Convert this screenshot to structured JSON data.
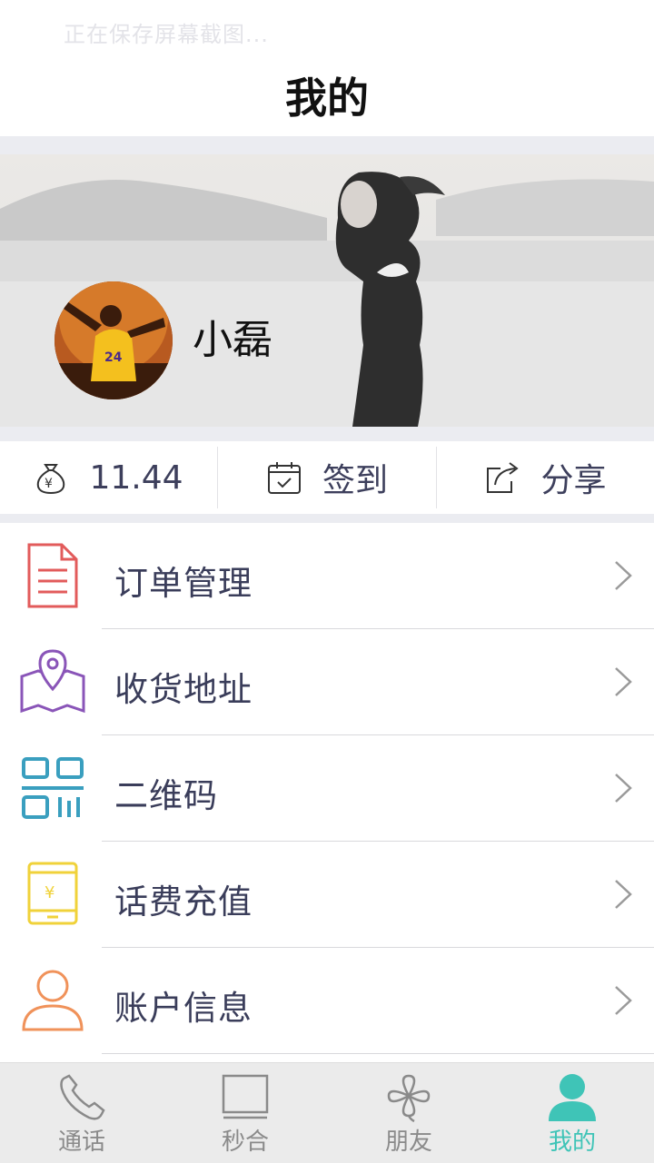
{
  "status": {
    "toast": "正在保存屏幕截图..."
  },
  "header": {
    "title": "我的"
  },
  "profile": {
    "name": "小磊",
    "avatar_icon": "user-avatar"
  },
  "quick_actions": [
    {
      "icon": "money-bag-icon",
      "label": "11.44"
    },
    {
      "icon": "calendar-check-icon",
      "label": "签到"
    },
    {
      "icon": "share-icon",
      "label": "分享"
    }
  ],
  "menu": [
    {
      "icon": "document-icon",
      "label": "订单管理",
      "color": "#e25b5b"
    },
    {
      "icon": "map-pin-icon",
      "label": "收货地址",
      "color": "#8a55b8"
    },
    {
      "icon": "qr-code-icon",
      "label": "二维码",
      "color": "#3a9fbf"
    },
    {
      "icon": "phone-yuan-icon",
      "label": "话费充值",
      "color": "#f0d23a"
    },
    {
      "icon": "user-outline-icon",
      "label": "账户信息",
      "color": "#f0925a"
    }
  ],
  "tabs": [
    {
      "icon": "phone-icon",
      "label": "通话",
      "active": false
    },
    {
      "icon": "screen-icon",
      "label": "秒合",
      "active": false
    },
    {
      "icon": "clover-icon",
      "label": "朋友",
      "active": false
    },
    {
      "icon": "person-icon",
      "label": "我的",
      "active": true
    }
  ],
  "colors": {
    "accent": "#3fc4b7",
    "text": "#3a3d5a",
    "divider_bg": "#ebecf1"
  }
}
